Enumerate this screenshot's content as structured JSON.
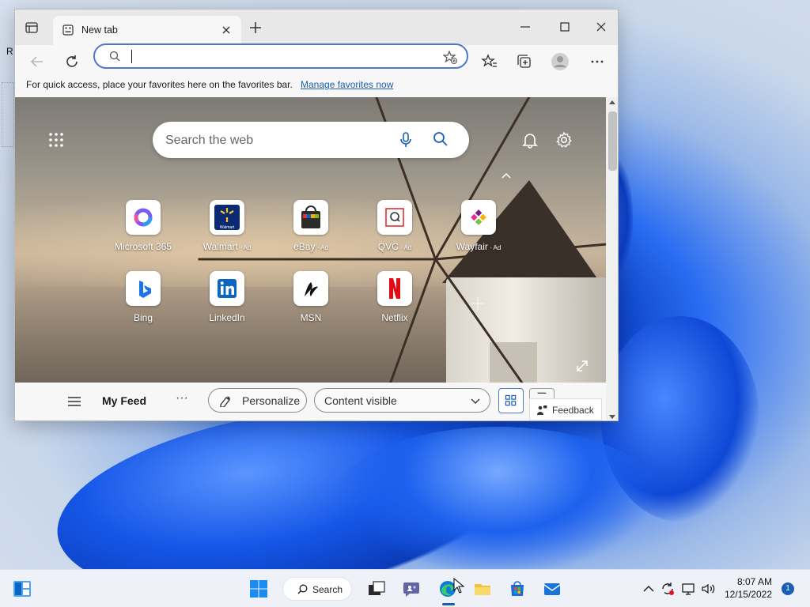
{
  "browser": {
    "tab": {
      "title": "New tab"
    },
    "favorites_bar": {
      "message": "For quick access, place your favorites here on the favorites bar.",
      "link": "Manage favorites now"
    },
    "newtab": {
      "search_placeholder": "Search the web",
      "quick_links": [
        {
          "label": "Microsoft 365",
          "ad": ""
        },
        {
          "label": "Walmart",
          "ad": " · Ad"
        },
        {
          "label": "eBay",
          "ad": " · Ad"
        },
        {
          "label": "QVC",
          "ad": " · Ad"
        },
        {
          "label": "Wayfair",
          "ad": " · Ad"
        },
        {
          "label": "Bing",
          "ad": ""
        },
        {
          "label": "LinkedIn",
          "ad": ""
        },
        {
          "label": "MSN",
          "ad": ""
        },
        {
          "label": "Netflix",
          "ad": ""
        }
      ],
      "feed": {
        "title": "My Feed",
        "more": "···",
        "personalize": "Personalize",
        "content_visibility": "Content visible",
        "feedback": "Feedback"
      }
    }
  },
  "taskbar": {
    "search_label": "Search",
    "time": "8:07 AM",
    "date": "12/15/2022",
    "notification_count": "1"
  },
  "desktop": {
    "icon_text": "R"
  }
}
